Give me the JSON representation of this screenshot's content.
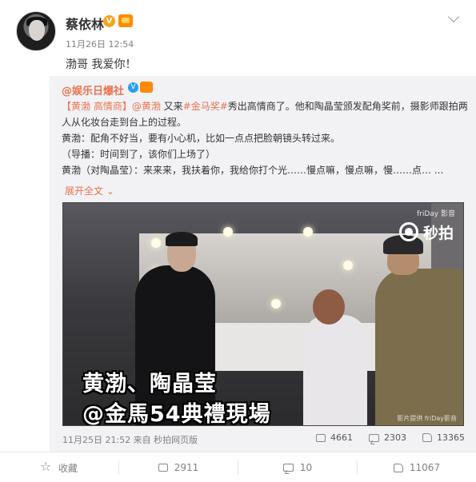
{
  "author": {
    "name": "蔡依林",
    "verified_icon": "V",
    "time": "11月26日 12:54",
    "text": "渤哥 我爱你！"
  },
  "repost": {
    "author": "@娱乐日爆社",
    "verified_icon": "V",
    "lines": {
      "l1_a": "【黄渤 高情商】",
      "l1_mention": "@黄渤",
      "l1_b": " 又来",
      "l1_topic": "#金马奖#",
      "l1_c": "秀出高情商了。他和陶晶莹颁发配角奖前，摄影师跟拍两",
      "l2": "人从化妆台走到台上的过程。",
      "l3": "黄渤：配角不好当，要有小心机，比如一点点把脸朝镜头转过来。",
      "l4": "（导播：时间到了，该你们上场了）",
      "l5": "黄渤（对陶晶莹）：来来来，我扶着你，我给你打个光……慢点嘛，慢点嘛，慢……点…  ..."
    },
    "expand": "展开全文 ⌄",
    "video": {
      "watermark_small": "friDay 影音",
      "watermark_logo": "秒拍",
      "caption_line1": "黄渤、陶晶莹",
      "caption_line2": "@金馬54典禮現場",
      "credit": "影片提供 friDay影音"
    },
    "meta": "11月25日 21:52 来自 秒拍网页版",
    "stats": {
      "reposts": "4661",
      "comments": "2303",
      "likes": "13365"
    }
  },
  "actions": {
    "favorite": "收藏",
    "repost": "2911",
    "comment": "10",
    "like": "11067"
  }
}
